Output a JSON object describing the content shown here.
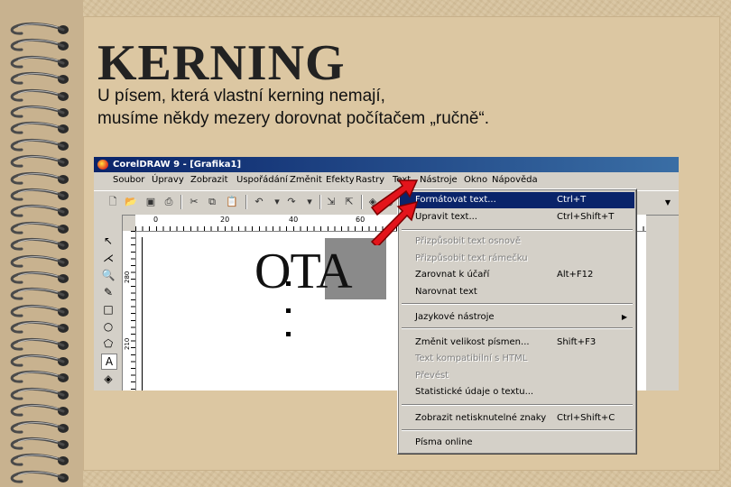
{
  "slide": {
    "title": "KERNING",
    "subtitle_line1": "U písem, která vlastní kerning nemají,",
    "subtitle_line2": "musíme někdy mezery dorovnat počítačem „ručně“."
  },
  "app": {
    "window_title": "CorelDRAW 9 - [Grafika1]",
    "menus": [
      "Soubor",
      "Úpravy",
      "Zobrazit",
      "Uspořádání",
      "Změnit",
      "Efekty",
      "Rastry",
      "Text",
      "Nástroje",
      "Okno",
      "Nápověda"
    ],
    "ruler_top_labels": [
      "0",
      "20",
      "40",
      "60"
    ],
    "ruler_left_labels": [
      "280",
      "210"
    ],
    "canvas_text": "OTA"
  },
  "text_menu": {
    "items": [
      {
        "label": "Formátovat text...",
        "shortcut": "Ctrl+T",
        "state": "highlighted"
      },
      {
        "label": "Upravit text...",
        "shortcut": "Ctrl+Shift+T",
        "state": "enabled"
      },
      {
        "label": "Přizpůsobit text osnově",
        "shortcut": "",
        "state": "disabled"
      },
      {
        "label": "Přizpůsobit text rámečku",
        "shortcut": "",
        "state": "disabled"
      },
      {
        "label": "Zarovnat k účaří",
        "shortcut": "Alt+F12",
        "state": "enabled"
      },
      {
        "label": "Narovnat text",
        "shortcut": "",
        "state": "enabled"
      },
      {
        "label": "Jazykové nástroje",
        "shortcut": "",
        "state": "submenu"
      },
      {
        "label": "Změnit velikost písmen...",
        "shortcut": "Shift+F3",
        "state": "enabled"
      },
      {
        "label": "Text kompatibilní s HTML",
        "shortcut": "",
        "state": "disabled"
      },
      {
        "label": "Převést",
        "shortcut": "",
        "state": "disabled"
      },
      {
        "label": "Statistické údaje o textu...",
        "shortcut": "",
        "state": "enabled"
      },
      {
        "label": "Zobrazit netisknutelné znaky",
        "shortcut": "Ctrl+Shift+C",
        "state": "enabled"
      },
      {
        "label": "Písma online",
        "shortcut": "",
        "state": "enabled"
      }
    ]
  },
  "colors": {
    "title_bar": "#0a246a",
    "highlight": "#0a246a",
    "arrow_red": "#e3141b",
    "page": "#d8c39e"
  },
  "icons": [
    "spiral-ring-icon",
    "new-file-icon",
    "open-file-icon",
    "save-icon",
    "print-icon",
    "cut-icon",
    "copy-icon",
    "paste-icon",
    "undo-icon",
    "redo-icon",
    "import-icon",
    "export-icon",
    "pick-tool-icon",
    "shape-tool-icon",
    "zoom-tool-icon",
    "freehand-tool-icon",
    "rectangle-tool-icon",
    "ellipse-tool-icon",
    "polygon-tool-icon",
    "text-tool-icon",
    "fill-tool-icon",
    "red-arrow-icon",
    "submenu-arrow-icon"
  ]
}
